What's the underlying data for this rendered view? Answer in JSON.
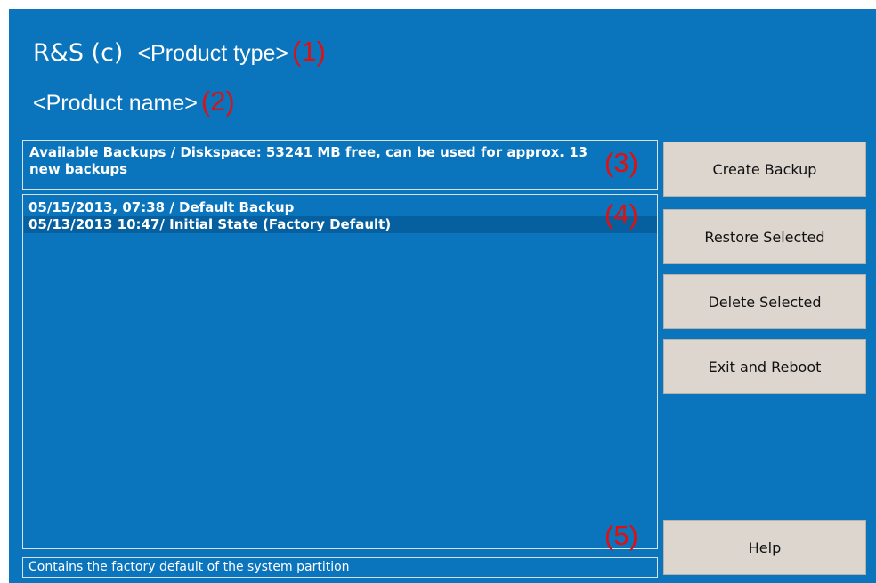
{
  "header": {
    "brand": "R&S (c)",
    "product_type": "<Product type>",
    "product_type_marker": "(1)",
    "product_name": "<Product name>",
    "product_name_marker": "(2)"
  },
  "disk_info": {
    "text": "Available Backups / Diskspace: 53241 MB free, can be used for approx. 13 new backups",
    "marker": "(3)"
  },
  "backup_list": {
    "marker": "(4)",
    "items": [
      {
        "label": "05/15/2013, 07:38 / Default Backup",
        "selected": false
      },
      {
        "label": "05/13/2013  10:47/ Initial State (Factory Default)",
        "selected": true
      }
    ]
  },
  "status_bar": {
    "text": "Contains the factory default of the system partition",
    "marker": "(5)"
  },
  "buttons": {
    "create_backup": "Create Backup",
    "restore_selected": "Restore Selected",
    "delete_selected": "Delete Selected",
    "exit_reboot": "Exit and Reboot",
    "help": "Help"
  },
  "colors": {
    "background": "#0a74bc",
    "selection": "#0660a0",
    "marker": "#e01010",
    "button": "#dcd6ce"
  }
}
